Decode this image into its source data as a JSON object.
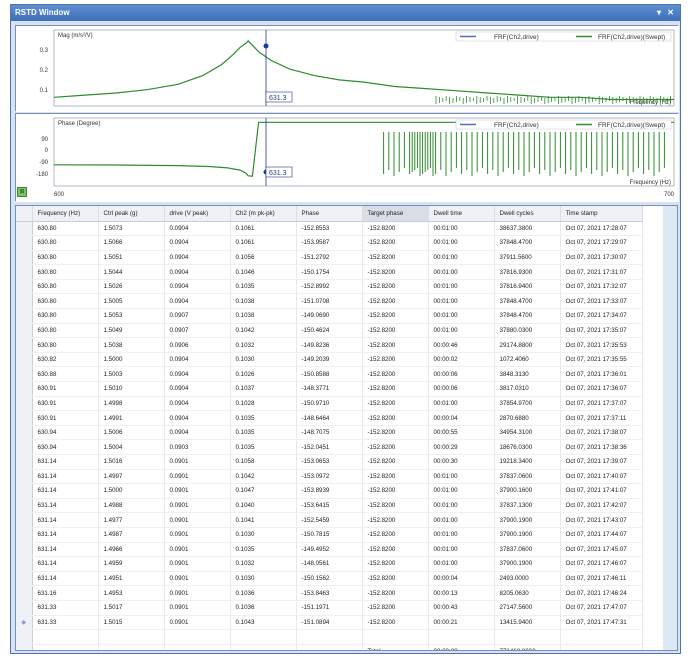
{
  "window": {
    "title": "RSTD Window",
    "buttons": [
      "▾",
      "✕"
    ]
  },
  "mag_chart": {
    "title": "Mag (m/s²/V)",
    "xlabel": "Frequency (Hz)",
    "legend": [
      "FRF(Ch2,drive)",
      "FRF(Ch2,drive)(Swept)"
    ],
    "yticks": [
      "0.3",
      "0.2",
      "0.1"
    ],
    "cursor_label": "631.3"
  },
  "phase_chart": {
    "title": "Phase (Degree)",
    "xlabel": "Frequency (Hz)",
    "legend": [
      "FRF(Ch2,drive)",
      "FRF(Ch2,drive)(Swept)"
    ],
    "yticks": [
      "90",
      "0",
      "-90",
      "-180"
    ],
    "cursor_label": "631.3",
    "x_min_label": "600",
    "x_max_label": "700"
  },
  "colors": {
    "series1": "#5a6fb3",
    "series2": "#2e8b2e",
    "cursor": "#2a3a8c"
  },
  "chart_data": [
    {
      "type": "line",
      "title": "Mag (m/s²/V)",
      "xlabel": "Frequency (Hz)",
      "xlim": [
        600,
        700
      ],
      "ylim": [
        0,
        0.35
      ],
      "series": [
        {
          "name": "FRF(Ch2,drive)(Swept)",
          "x": [
            600,
            605,
            610,
            615,
            620,
            624,
            627,
            629,
            630,
            631,
            631.3,
            632,
            633,
            635,
            638,
            642,
            646,
            650,
            655,
            660,
            665,
            670,
            675,
            680,
            685,
            690,
            695,
            700
          ],
          "y": [
            0.04,
            0.05,
            0.06,
            0.075,
            0.1,
            0.14,
            0.19,
            0.24,
            0.27,
            0.29,
            0.3,
            0.28,
            0.25,
            0.21,
            0.17,
            0.14,
            0.12,
            0.11,
            0.09,
            0.08,
            0.07,
            0.06,
            0.05,
            0.04,
            0.04,
            0.03,
            0.03,
            0.03
          ]
        }
      ]
    },
    {
      "type": "line",
      "title": "Phase (Degree)",
      "xlabel": "Frequency (Hz)",
      "xlim": [
        600,
        700
      ],
      "ylim": [
        -200,
        120
      ],
      "series": [
        {
          "name": "FRF(Ch2,drive)(Swept)",
          "x": [
            600,
            610,
            620,
            625,
            628,
            630,
            631,
            631.3,
            632,
            633,
            640,
            650,
            660,
            670,
            680,
            690,
            700
          ],
          "y": [
            -100,
            -101,
            -104,
            -108,
            -115,
            -125,
            -140,
            -152,
            -154,
            100,
            100,
            100,
            100,
            100,
            100,
            100,
            100
          ]
        }
      ]
    }
  ],
  "table": {
    "headers": [
      "Frequency (Hz)",
      "Ctrl peak (g)",
      "drive (V peak)",
      "Ch2 (m pk-pk)",
      "Phase",
      "Target phase",
      "Dwell time",
      "Dwell cycles",
      "Time stamp"
    ],
    "rows": [
      [
        "630.80",
        "1.5073",
        "0.0904",
        "0.1061",
        "-152.8553",
        "-152.8200",
        "00:01:00",
        "38637.3800",
        "Oct 07, 2021 17:28:07"
      ],
      [
        "630.80",
        "1.5066",
        "0.0904",
        "0.1061",
        "-153.9587",
        "-152.8200",
        "00:01:00",
        "37848.4700",
        "Oct 07, 2021 17:29:07"
      ],
      [
        "630.80",
        "1.5051",
        "0.0904",
        "0.1056",
        "-151.2792",
        "-152.8200",
        "00:01:00",
        "37911.5600",
        "Oct 07, 2021 17:30:07"
      ],
      [
        "630.80",
        "1.5044",
        "0.0904",
        "0.1046",
        "-150.1754",
        "-152.8200",
        "00:01:00",
        "37816.9300",
        "Oct 07, 2021 17:31:07"
      ],
      [
        "630.80",
        "1.5026",
        "0.0904",
        "0.1035",
        "-152.8992",
        "-152.8200",
        "00:01:00",
        "37816.9400",
        "Oct 07, 2021 17:32:07"
      ],
      [
        "630.80",
        "1.5005",
        "0.0904",
        "0.1038",
        "-151.0708",
        "-152.8200",
        "00:01:00",
        "37848.4700",
        "Oct 07, 2021 17:33:07"
      ],
      [
        "630.80",
        "1.5053",
        "0.0907",
        "0.1038",
        "-149.0690",
        "-152.8200",
        "00:01:00",
        "37848.4700",
        "Oct 07, 2021 17:34:07"
      ],
      [
        "630.80",
        "1.5049",
        "0.0907",
        "0.1042",
        "-150.4624",
        "-152.8200",
        "00:01:00",
        "37880.0300",
        "Oct 07, 2021 17:35:07"
      ],
      [
        "630.80",
        "1.5038",
        "0.0906",
        "0.1032",
        "-149.8236",
        "-152.8200",
        "00:00:46",
        "29174.8800",
        "Oct 07, 2021 17:35:53"
      ],
      [
        "630.82",
        "1.5000",
        "0.0904",
        "0.1030",
        "-149.2039",
        "-152.8200",
        "00:00:02",
        "1072.4060",
        "Oct 07, 2021 17:35:55"
      ],
      [
        "630.88",
        "1.5003",
        "0.0904",
        "0.1026",
        "-150.8588",
        "-152.8200",
        "00:00:06",
        "3848.3130",
        "Oct 07, 2021 17:36:01"
      ],
      [
        "630.91",
        "1.5010",
        "0.0904",
        "0.1037",
        "-148.3771",
        "-152.8200",
        "00:00:06",
        "3817.0310",
        "Oct 07, 2021 17:36:07"
      ],
      [
        "630.91",
        "1.4998",
        "0.0904",
        "0.1028",
        "-150.9710",
        "-152.8200",
        "00:01:00",
        "37854.9700",
        "Oct 07, 2021 17:37:07"
      ],
      [
        "630.91",
        "1.4991",
        "0.0904",
        "0.1035",
        "-148.6464",
        "-152.8200",
        "00:00:04",
        "2870.6880",
        "Oct 07, 2021 17:37:11"
      ],
      [
        "630.94",
        "1.5006",
        "0.0904",
        "0.1035",
        "-148.7075",
        "-152.8200",
        "00:00:55",
        "34954.3100",
        "Oct 07, 2021 17:38:07"
      ],
      [
        "630.94",
        "1.5004",
        "0.0903",
        "0.1035",
        "-152.0451",
        "-152.8200",
        "00:00:29",
        "18676.0300",
        "Oct 07, 2021 17:38:36"
      ],
      [
        "631.14",
        "1.5016",
        "0.0901",
        "0.1058",
        "-153.0653",
        "-152.8200",
        "00:00:30",
        "19218.3400",
        "Oct 07, 2021 17:39:07"
      ],
      [
        "631.14",
        "1.4997",
        "0.0901",
        "0.1042",
        "-153.0972",
        "-152.8200",
        "00:01:00",
        "37837.0600",
        "Oct 07, 2021 17:40:07"
      ],
      [
        "631.14",
        "1.5000",
        "0.0901",
        "0.1047",
        "-153.8939",
        "-152.8200",
        "00:01:00",
        "37900.1600",
        "Oct 07, 2021 17:41:07"
      ],
      [
        "631.14",
        "1.4988",
        "0.0901",
        "0.1040",
        "-153.6415",
        "-152.8200",
        "00:01:00",
        "37837.1300",
        "Oct 07, 2021 17:42:07"
      ],
      [
        "631.14",
        "1.4977",
        "0.0901",
        "0.1041",
        "-152.5459",
        "-152.8200",
        "00:01:00",
        "37900.1900",
        "Oct 07, 2021 17:43:07"
      ],
      [
        "631.14",
        "1.4987",
        "0.0901",
        "0.1030",
        "-150.7815",
        "-152.8200",
        "00:01:00",
        "37900.1900",
        "Oct 07, 2021 17:44:07"
      ],
      [
        "631.14",
        "1.4966",
        "0.0901",
        "0.1035",
        "-149.4952",
        "-152.8200",
        "00:01:00",
        "37837.0600",
        "Oct 07, 2021 17:45:07"
      ],
      [
        "631.14",
        "1.4959",
        "0.0901",
        "0.1032",
        "-148.0561",
        "-152.8200",
        "00:01:00",
        "37900.1900",
        "Oct 07, 2021 17:46:07"
      ],
      [
        "631.14",
        "1.4951",
        "0.0901",
        "0.1030",
        "-150.1562",
        "-152.8200",
        "00:00:04",
        "2493.0000",
        "Oct 07, 2021 17:46:11"
      ],
      [
        "631.16",
        "1.4953",
        "0.0901",
        "0.1036",
        "-153.8463",
        "-152.8200",
        "00:00:13",
        "8205.0630",
        "Oct 07, 2021 17:46:24"
      ],
      [
        "631.33",
        "1.5017",
        "0.0901",
        "0.1036",
        "-151.1971",
        "-152.8200",
        "00:00:43",
        "27147.5600",
        "Oct 07, 2021 17:47:07"
      ],
      [
        "631.33",
        "1.5015",
        "0.0901",
        "0.1043",
        "-151.0894",
        "-152.8200",
        "00:00:21",
        "13415.9400",
        "Oct 07, 2021 17:47:31"
      ]
    ],
    "total": {
      "label": "Total",
      "dwell_time": "00:20:20",
      "dwell_cycles": "771468.8000"
    }
  }
}
